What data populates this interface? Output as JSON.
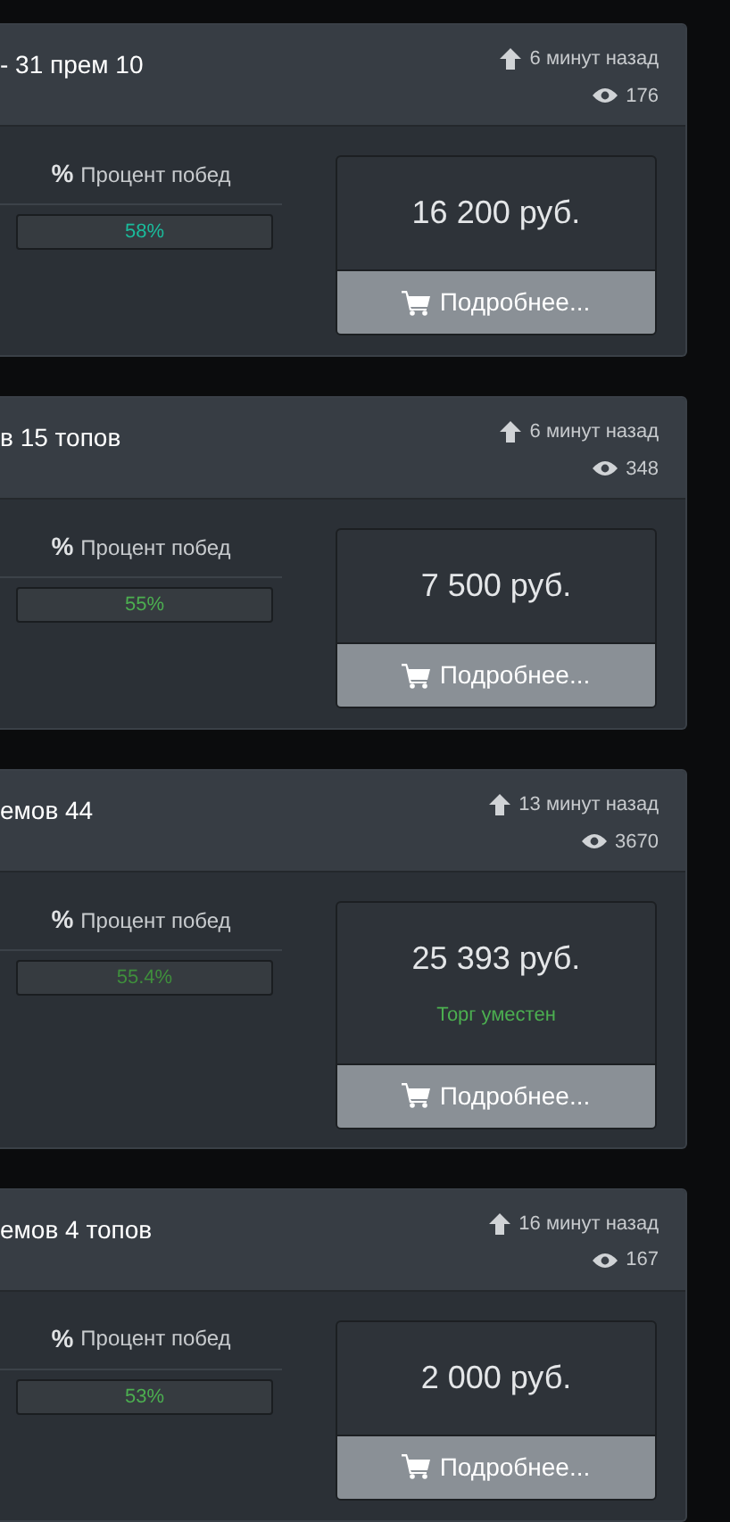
{
  "listings": [
    {
      "title": "- 31 прем 10",
      "posted": "6 минут назад",
      "views": "176",
      "winrate_icon": "%",
      "winrate_label": "Процент побед",
      "winrate": {
        "text": "58%",
        "color": "#1abc9c"
      },
      "price": "16 200 руб.",
      "details_button": "Подробнее..."
    },
    {
      "title": "в 15 топов",
      "posted": "6 минут назад",
      "views": "348",
      "winrate_icon": "%",
      "winrate_label": "Процент побед",
      "winrate": {
        "text": "55%",
        "color": "#4caf50"
      },
      "price": "7 500 руб.",
      "details_button": "Подробнее..."
    },
    {
      "title": "емов 44",
      "posted": "13 минут назад",
      "views": "3670",
      "winrate_icon": "%",
      "winrate_label": "Процент побед",
      "winrate": {
        "text": "55.4%",
        "color": "#3f8f3c"
      },
      "price": "25 393 руб.",
      "note": "Торг уместен",
      "details_button": "Подробнее..."
    },
    {
      "title": "емов 4 топов",
      "posted": "16 минут назад",
      "views": "167",
      "winrate_icon": "%",
      "winrate_label": "Процент побед",
      "winrate": {
        "text": "53%",
        "color": "#4caf50"
      },
      "price": "2 000 руб.",
      "details_button": "Подробнее..."
    }
  ]
}
